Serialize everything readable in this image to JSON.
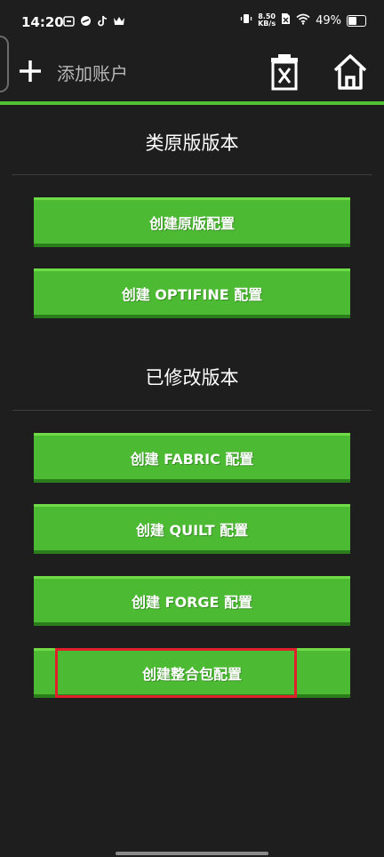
{
  "status_bar": {
    "time": "14:20",
    "net_speed_value": "8.50",
    "net_speed_unit": "KB/s",
    "battery_percent": "49%"
  },
  "app_bar": {
    "account_label": "添加账户"
  },
  "sections": {
    "vanilla_title": "类原版版本",
    "modded_title": "已修改版本"
  },
  "buttons": {
    "create_vanilla": "创建原版配置",
    "create_optifine": "创建 OPTIFINE 配置",
    "create_fabric": "创建 FABRIC 配置",
    "create_quilt": "创建 QUILT 配置",
    "create_forge": "创建 FORGE 配置",
    "create_modpack": "创建整合包配置"
  },
  "colors": {
    "accent": "#52c234",
    "button_green": "#4cbb33",
    "highlight_red": "#e0202a",
    "background": "#1e1e1e"
  }
}
